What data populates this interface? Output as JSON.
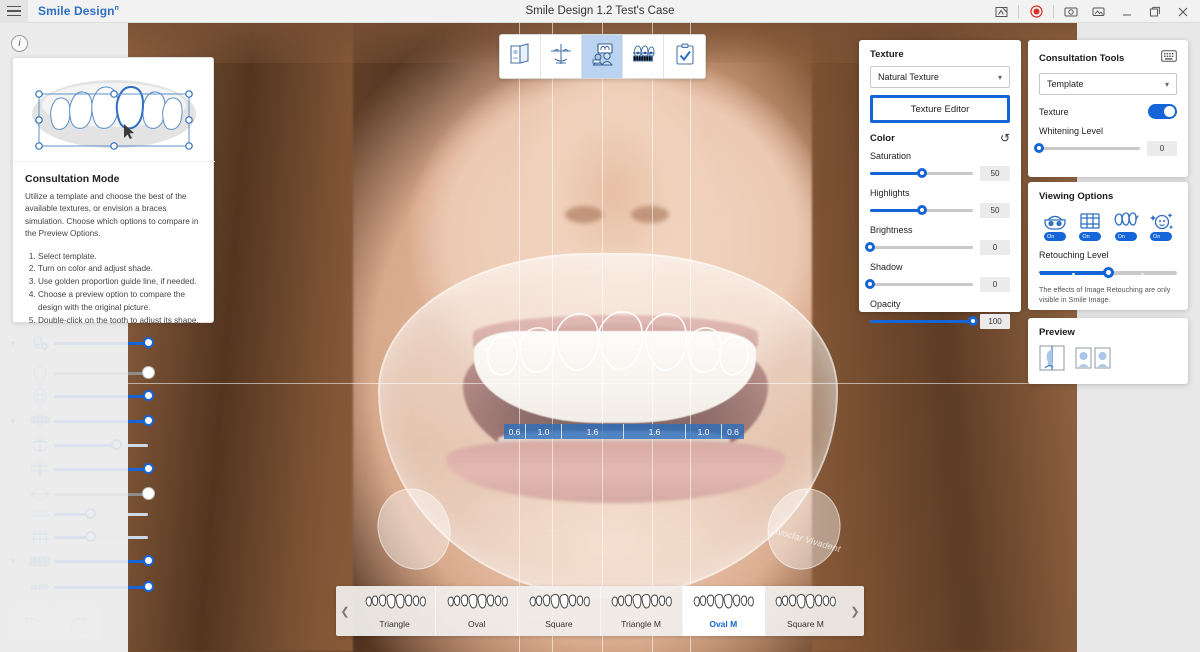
{
  "titlebar": {
    "menu_icon": "hamburger-icon",
    "app_name": "Smile Design",
    "app_name_sup": "п",
    "document_title": "Smile Design 1.2 Test's Case",
    "controls": [
      {
        "name": "screenshot-compare-icon",
        "glyph": "⛶"
      },
      {
        "name": "record-icon",
        "glyph": "◉"
      },
      {
        "name": "camera-icon",
        "glyph": "□"
      },
      {
        "name": "gallery-icon",
        "glyph": "⬚"
      },
      {
        "name": "minimize-icon",
        "glyph": "—"
      },
      {
        "name": "maximize-icon",
        "glyph": "❐"
      },
      {
        "name": "close-icon",
        "glyph": "✕"
      }
    ]
  },
  "info_badge": {
    "label": "i"
  },
  "template_card": {
    "heading": "Consultation Mode",
    "description": "Utilize a template and choose the best of the available textures, or envision a braces simulation. Choose which options to compare in the Preview Options.",
    "steps": [
      "Select template.",
      "Turn on color and adjust shade.",
      "Use golden proportion guide line, if needed.",
      "Choose a preview option to compare the design with the original picture.",
      "Double-click on the tooth to adjust its shape."
    ]
  },
  "sidebar_sliders": [
    {
      "name": "smile-curve-slider",
      "icon": "face-smile-icon",
      "value": 100,
      "has_caret": true,
      "style": "blue"
    },
    {
      "name": "face-shape-slider",
      "icon": "face-oval-icon",
      "value": 100,
      "has_caret": false,
      "style": "grey"
    },
    {
      "name": "face-detail-slider",
      "icon": "face-detail-icon",
      "value": 100,
      "has_caret": false,
      "style": "blue"
    },
    {
      "name": "teeth-arch-slider",
      "icon": "teeth-arch-icon",
      "value": 100,
      "has_caret": true,
      "style": "blue"
    },
    {
      "name": "midline-slider",
      "icon": "midline-cross-icon",
      "value": 66,
      "has_caret": false,
      "style": "blue"
    },
    {
      "name": "axis-slider",
      "icon": "axis-cross-icon",
      "value": 100,
      "has_caret": false,
      "style": "blue"
    },
    {
      "name": "lip-line-slider",
      "icon": "lips-icon",
      "value": 100,
      "has_caret": false,
      "style": "grey"
    },
    {
      "name": "incisal-edge-slider",
      "icon": "incisal-edge-icon",
      "value": 38,
      "has_caret": false,
      "style": "blue"
    },
    {
      "name": "tooth-axis-slider",
      "icon": "tooth-axis-icon",
      "value": 38,
      "has_caret": false,
      "style": "blue"
    },
    {
      "name": "braces-slider",
      "icon": "braces-icon",
      "value": 100,
      "has_caret": true,
      "style": "blue"
    },
    {
      "name": "retainer-slider",
      "icon": "retainer-icon",
      "value": 100,
      "has_caret": false,
      "style": "blue"
    }
  ],
  "undo_redo": [
    {
      "name": "undo-button",
      "label": "Undo",
      "icon": "undo-arrow-icon"
    },
    {
      "name": "redo-button",
      "label": "Redo",
      "icon": "redo-arrow-icon"
    }
  ],
  "toolbar": {
    "buttons": [
      {
        "name": "tool-photo-library",
        "icon": "photo-card-icon",
        "active": false
      },
      {
        "name": "tool-face-analysis",
        "icon": "face-axis-icon",
        "active": false
      },
      {
        "name": "tool-consultation",
        "icon": "consultation-icon",
        "active": true
      },
      {
        "name": "tool-braces",
        "icon": "braces-tool-icon",
        "active": false
      },
      {
        "name": "tool-checklist",
        "icon": "clipboard-check-icon",
        "active": false
      }
    ]
  },
  "texture_panel": {
    "heading": "Texture",
    "select_value": "Natural Texture",
    "editor_button": "Texture Editor",
    "color_heading": "Color",
    "reset_icon": "reset-arrow-icon",
    "sliders": [
      {
        "name": "saturation-slider",
        "label": "Saturation",
        "value": 50,
        "percent": 50
      },
      {
        "name": "highlights-slider",
        "label": "Highlights",
        "value": 50,
        "percent": 50
      },
      {
        "name": "brightness-slider",
        "label": "Brightness",
        "value": 0,
        "percent": 0
      },
      {
        "name": "shadow-slider",
        "label": "Shadow",
        "value": 0,
        "percent": 0
      },
      {
        "name": "opacity-slider",
        "label": "Opacity",
        "value": 100,
        "percent": 100
      }
    ]
  },
  "tools_panel": {
    "heading": "Consultation Tools",
    "keyboard_icon": "keyboard-icon",
    "select_value": "Template",
    "texture_label": "Texture",
    "texture_enabled": true,
    "whitening_label": "Whitening Level",
    "whitening_value": 0
  },
  "viewing_panel": {
    "heading": "Viewing Options",
    "options": [
      {
        "name": "view-mask-option",
        "icon": "mask-glasses-icon",
        "badge": "On"
      },
      {
        "name": "view-braces-option",
        "icon": "braces-view-icon",
        "badge": "On"
      },
      {
        "name": "view-teeth-option",
        "icon": "teeth-view-icon",
        "badge": "On"
      },
      {
        "name": "view-retouch-option",
        "icon": "face-sparkle-icon",
        "badge": "On"
      }
    ],
    "retouching_label": "Retouching Level",
    "retouching_steps": 5,
    "retouching_value": 3,
    "note": "The effects of Image Retouching are only visible in Smile Image."
  },
  "preview_panel": {
    "heading": "Preview",
    "items": [
      {
        "name": "preview-split-view",
        "icon": "split-face-icon"
      },
      {
        "name": "preview-side-by-side",
        "icon": "side-by-side-icon"
      }
    ]
  },
  "golden_proportion": {
    "values": [
      "0.6",
      "1.0",
      "1.6",
      "1.6",
      "1.0",
      "0.6"
    ],
    "widths": [
      22,
      36,
      62,
      62,
      36,
      22
    ]
  },
  "image_watermark": "Ivoclar Vivadent",
  "carousel": {
    "prev_icon": "chevron-left-icon",
    "next_icon": "chevron-right-icon",
    "items": [
      {
        "name": "template-triangle",
        "label": "Triangle",
        "active": false
      },
      {
        "name": "template-oval",
        "label": "Oval",
        "active": false
      },
      {
        "name": "template-square",
        "label": "Square",
        "active": false
      },
      {
        "name": "template-triangle-m",
        "label": "Triangle M",
        "active": false
      },
      {
        "name": "template-oval-m",
        "label": "Oval M",
        "active": true
      },
      {
        "name": "template-square-m",
        "label": "Square M",
        "active": false
      }
    ]
  },
  "colors": {
    "accent": "#1565d8",
    "title_blue": "#2f6fc0",
    "panel_bg": "#ffffff",
    "sidebar_bg": "#ececec",
    "record_red": "#d93025"
  }
}
